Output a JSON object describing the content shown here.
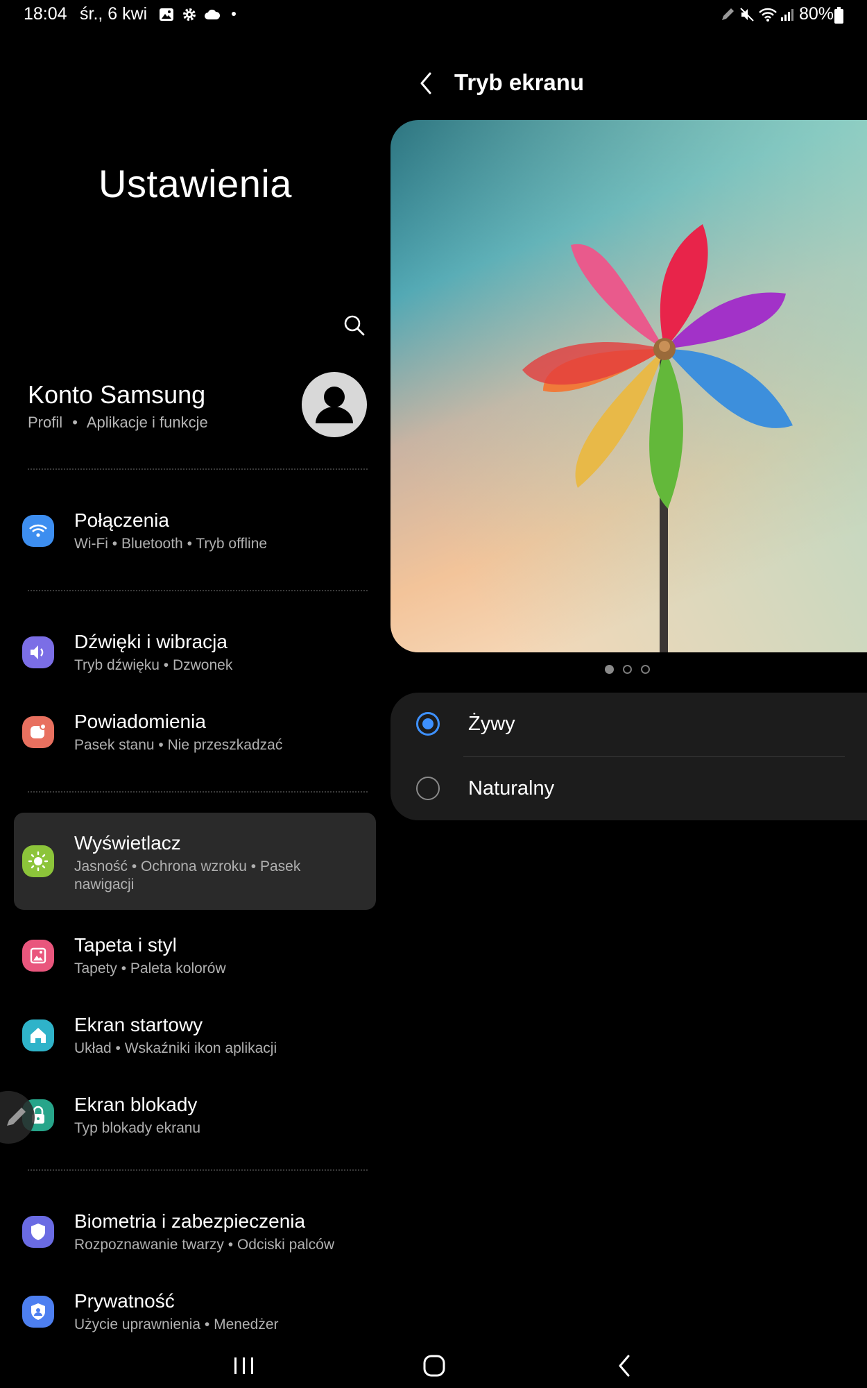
{
  "status_bar": {
    "time": "18:04",
    "date": "śr., 6 kwi",
    "battery": "80%"
  },
  "left": {
    "title": "Ustawienia",
    "account": {
      "name": "Konto Samsung",
      "sub1": "Profil",
      "sub2": "Aplikacje i funkcje"
    },
    "items": [
      {
        "title": "Połączenia",
        "sub": "Wi-Fi  •  Bluetooth  •  Tryb offline",
        "color": "#3d8ef0",
        "icon": "wifi-icon"
      },
      {
        "title": "Dźwięki i wibracja",
        "sub": "Tryb dźwięku  •  Dzwonek",
        "color": "#7b6ee6",
        "icon": "speaker-icon"
      },
      {
        "title": "Powiadomienia",
        "sub": "Pasek stanu  •  Nie przeszkadzać",
        "color": "#e8705f",
        "icon": "notification-icon"
      },
      {
        "title": "Wyświetlacz",
        "sub": "Jasność  •  Ochrona wzroku  •  Pasek nawigacji",
        "color": "#8cc43a",
        "icon": "sun-icon"
      },
      {
        "title": "Tapeta i styl",
        "sub": "Tapety  •  Paleta kolorów",
        "color": "#e9567d",
        "icon": "wallpaper-icon"
      },
      {
        "title": "Ekran startowy",
        "sub": "Układ  •  Wskaźniki ikon aplikacji",
        "color": "#2fb3c9",
        "icon": "home-icon"
      },
      {
        "title": "Ekran blokady",
        "sub": "Typ blokady ekranu",
        "color": "#27a58a",
        "icon": "lock-icon"
      },
      {
        "title": "Biometria i zabezpieczenia",
        "sub": "Rozpoznawanie twarzy  •  Odciski palców",
        "color": "#6a6be3",
        "icon": "shield-icon"
      },
      {
        "title": "Prywatność",
        "sub": "Użycie uprawnienia  •  Menedżer",
        "color": "#4d7ff0",
        "icon": "privacy-icon"
      }
    ]
  },
  "right": {
    "title": "Tryb ekranu",
    "options": [
      {
        "label": "Żywy",
        "selected": true
      },
      {
        "label": "Naturalny",
        "selected": false
      }
    ],
    "carousel": {
      "count": 3,
      "active": 1
    }
  },
  "colors": {
    "accent": "#3e91ff",
    "selected_bg": "#2a2a2a",
    "card_bg": "#1c1c1c"
  }
}
